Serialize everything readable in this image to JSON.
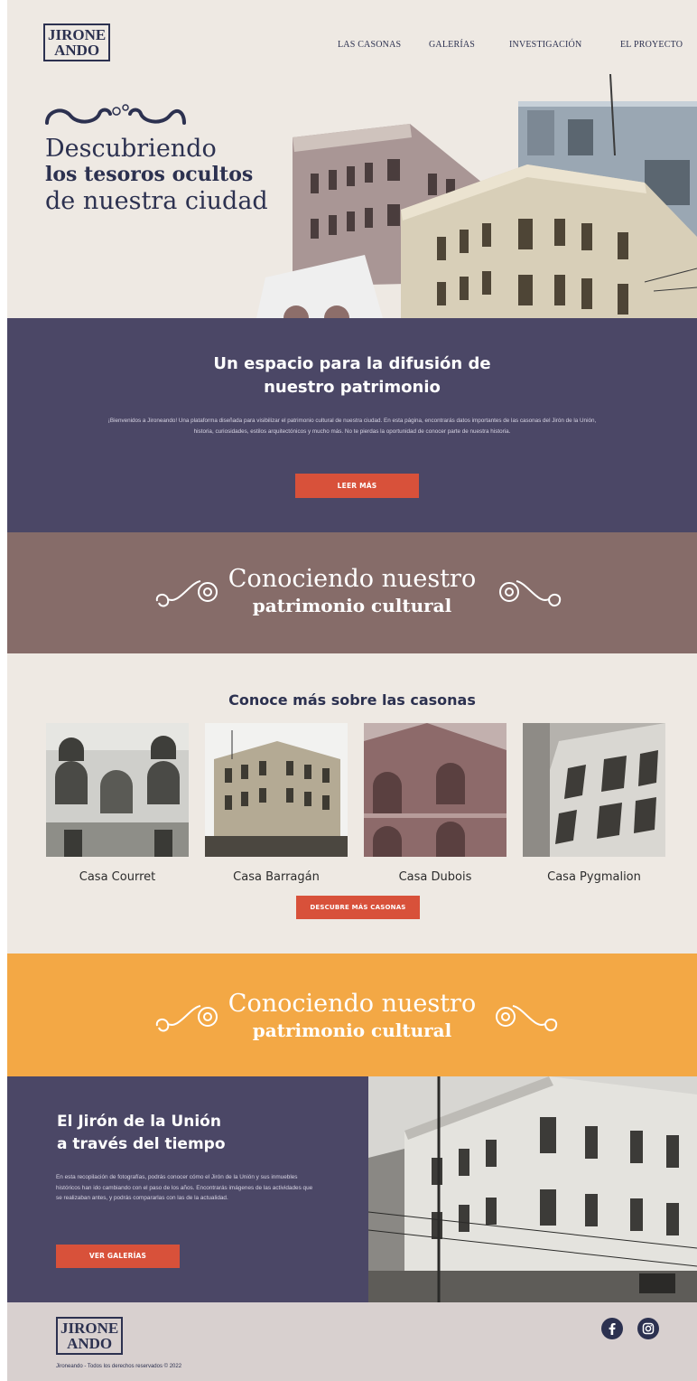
{
  "brand": {
    "logo_line1": "JIRONE",
    "logo_line2": "ANDO"
  },
  "nav": {
    "items": [
      "LAS CASONAS",
      "GALERÍAS",
      "INVESTIGACIÓN",
      "EL PROYECTO"
    ]
  },
  "hero": {
    "line1": "Descubriendo",
    "line2": "los tesoros ocultos",
    "line3": "de nuestra ciudad"
  },
  "intro": {
    "title_line1": "Un espacio para la difusión de",
    "title_line2": "nuestro patrimonio",
    "body": "¡Bienvenidos a Jironeando! Una plataforma diseñada para visibilizar el patrimonio cultural de nuestra ciudad. En esta página, encontrarás datos importantes de las casonas del Jirón de la Unión, historia, curiosidades, estilos arquitectónicos y mucho más.  No te pierdas la oportunidad de conocer parte de nuestra historia.",
    "button": "LEER MÁS"
  },
  "banner1": {
    "line1": "Conociendo nuestro",
    "line2": "patrimonio cultural"
  },
  "casonas": {
    "title": "Conoce más sobre las casonas",
    "cards": [
      {
        "name": "Casa Courret"
      },
      {
        "name": "Casa Barragán"
      },
      {
        "name": "Casa Dubois"
      },
      {
        "name": "Casa Pygmalion"
      }
    ],
    "button": "DESCUBRE MÁS CASONAS"
  },
  "banner2": {
    "line1": "Conociendo nuestro",
    "line2": "patrimonio cultural"
  },
  "jiron": {
    "title_line1": "El Jirón de la Unión",
    "title_line2": "a través del tiempo",
    "body": "En esta recopilación de fotografías, podrás conocer cómo el Jirón de la Unión y sus inmuebles históricos han ido cambiando con el paso de los años. Encontrarás imágenes de las actividades que se realizaban antes, y podrás compararlas con las de la actualidad.",
    "button": "VER GALERÍAS"
  },
  "footer": {
    "copyright": "Jironeando - Todos los derechos reservados © 2022",
    "social": [
      "facebook-icon",
      "instagram-icon"
    ]
  },
  "colors": {
    "navy": "#2c3150",
    "cream": "#eee9e3",
    "purple": "#4b4766",
    "mauve": "#866c69",
    "orange": "#f3a845",
    "red": "#d8513a",
    "footer": "#d8d0cf"
  }
}
